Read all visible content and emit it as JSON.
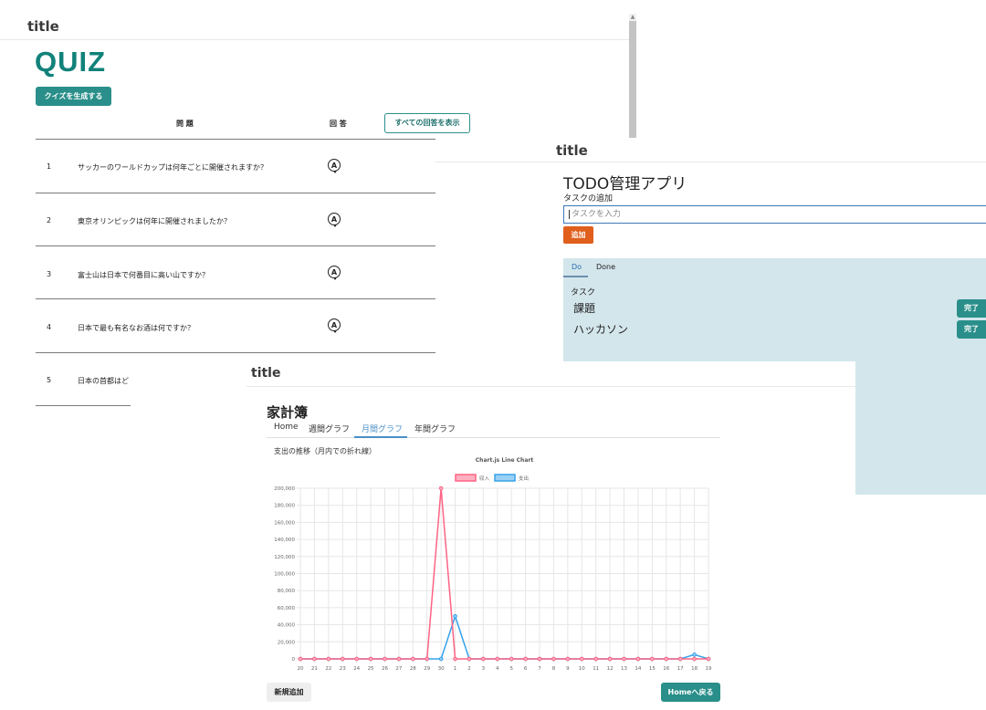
{
  "quiz_window": {
    "app_title": "title",
    "heading": "QUIZ",
    "generate_button": "クイズを生成する",
    "columns": {
      "question": "問 題",
      "answer": "回 答"
    },
    "show_all_button": "すべての回答を表示",
    "answer_icon": "A",
    "questions": [
      {
        "num": "1",
        "text": "サッカーのワールドカップは何年ごとに開催されますか？"
      },
      {
        "num": "2",
        "text": "東京オリンピックは何年に開催されましたか？"
      },
      {
        "num": "3",
        "text": "富士山は日本で何番目に高い山ですか？"
      },
      {
        "num": "4",
        "text": "日本で最も有名なお酒は何ですか？"
      },
      {
        "num": "5",
        "text": "日本の首都はど"
      }
    ]
  },
  "todo_window": {
    "app_title": "title",
    "heading": "TODO管理アプリ",
    "add_label": "タスクの追加",
    "input_placeholder": "タスクを入力",
    "add_button": "追加",
    "tabs": [
      "Do",
      "Done"
    ],
    "task_label": "タスク",
    "tasks": [
      "課題",
      "ハッカソン"
    ],
    "complete_button": "完了"
  },
  "kakeibo_window": {
    "app_title": "title",
    "heading": "家計簿",
    "nav": [
      "Home",
      "週間グラフ",
      "月間グラフ",
      "年間グラフ"
    ],
    "active_nav": "月間グラフ",
    "subtitle": "支出の推移（月内での折れ線）",
    "new_button": "新規追加",
    "home_button": "Homeへ戻る"
  },
  "colors": {
    "teal": "#2a8f8a",
    "orange": "#e05f1c",
    "income_line": "#ff6384",
    "expense_line": "#36a2eb",
    "panel_bg": "#d3e6ec"
  },
  "chart_data": {
    "type": "line",
    "title": "Chart.js Line Chart",
    "x": [
      "20",
      "21",
      "22",
      "23",
      "24",
      "25",
      "26",
      "27",
      "28",
      "29",
      "30",
      "1",
      "2",
      "3",
      "4",
      "5",
      "6",
      "7",
      "8",
      "9",
      "10",
      "11",
      "12",
      "13",
      "14",
      "15",
      "16",
      "17",
      "18",
      "19"
    ],
    "series": [
      {
        "name": "収入",
        "values": [
          0,
          0,
          0,
          0,
          0,
          0,
          0,
          0,
          0,
          0,
          200000,
          0,
          0,
          0,
          0,
          0,
          0,
          0,
          0,
          0,
          0,
          0,
          0,
          0,
          0,
          0,
          0,
          0,
          0,
          0
        ]
      },
      {
        "name": "支出",
        "values": [
          0,
          0,
          0,
          0,
          0,
          0,
          0,
          0,
          0,
          0,
          0,
          50000,
          0,
          0,
          0,
          0,
          0,
          0,
          0,
          0,
          0,
          0,
          0,
          0,
          0,
          0,
          0,
          0,
          5000,
          0
        ]
      }
    ],
    "ylim": [
      0,
      200000
    ],
    "yticks": [
      "0",
      "20,000",
      "40,000",
      "60,000",
      "80,000",
      "100,000",
      "120,000",
      "140,000",
      "160,000",
      "180,000",
      "200,000"
    ],
    "grid": true,
    "legend": "top"
  }
}
